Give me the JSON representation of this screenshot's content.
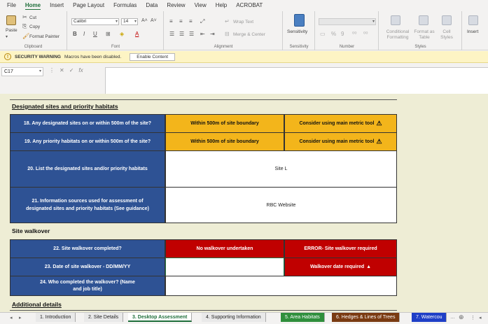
{
  "menu": {
    "tabs": [
      "File",
      "Home",
      "Insert",
      "Page Layout",
      "Formulas",
      "Data",
      "Review",
      "View",
      "Help",
      "ACROBAT"
    ],
    "active": "Home"
  },
  "ribbon": {
    "clipboard": {
      "paste": "Paste",
      "cut": "Cut",
      "copy": "Copy",
      "format_painter": "Format Painter",
      "label": "Clipboard"
    },
    "font": {
      "family": "Calibri",
      "size": "14",
      "label": "Font"
    },
    "alignment": {
      "wrap_text": "Wrap Text",
      "merge_center": "Merge & Center",
      "label": "Alignment"
    },
    "sensitivity": {
      "button": "Sensitivity",
      "label": "Sensitivity"
    },
    "number": {
      "label": "Number"
    },
    "styles": {
      "conditional": "Conditional Formatting",
      "format_table": "Format as Table",
      "cell_styles": "Cell Styles",
      "label": "Styles"
    },
    "cells": {
      "insert": "Insert"
    }
  },
  "security": {
    "title": "SECURITY WARNING",
    "message": "Macros have been disabled.",
    "button": "Enable Content"
  },
  "formula_bar": {
    "name_box": "C17",
    "fx": "fx",
    "value": ""
  },
  "sheet": {
    "section1": "Designated sites and priority habitats",
    "rows1": [
      {
        "q": "18. Any designated sites on or within 500m of the site?",
        "a": "Within 500m of site boundary",
        "b": "Consider using main metric tool"
      },
      {
        "q": "19. Any priority habitats on or within 500m of the site?",
        "a": "Within 500m of site boundary",
        "b": "Consider using main metric tool"
      },
      {
        "q": "20. List the designated sites and/or priority habitats",
        "v": "Site L"
      },
      {
        "q": "21. Information sources used for assessment of designated sites and priority habitats (See guidance)",
        "v": "RBC Website"
      }
    ],
    "section2": "Site walkover",
    "rows2": [
      {
        "q": "22. Site walkover completed?",
        "a": "No walkover undertaken",
        "b": "ERROR- Site walkover required"
      },
      {
        "q": "23. Date of site walkover - DD/MM/YY",
        "a": "",
        "b": "Walkover date required"
      },
      {
        "q": "24. Who completed the walkover? (Name and job title)",
        "v": ""
      }
    ],
    "section3": "Additional details",
    "warning_glyph": "⚠",
    "up_glyph": "▲"
  },
  "sheet_tabs": [
    {
      "label": "1. Introduction",
      "style": "plain"
    },
    {
      "label": "2. Site Details",
      "style": "plain"
    },
    {
      "label": "3. Desktop Assessment",
      "style": "active"
    },
    {
      "label": "4. Supporting Information",
      "style": "plain"
    },
    {
      "label": "5. Area Habitats",
      "style": "green"
    },
    {
      "label": "6. Hedges & Lines of Trees",
      "style": "brown"
    },
    {
      "label": "7. Watercou",
      "style": "blue"
    }
  ],
  "colors": {
    "excel_green": "#1e6e3a",
    "question_blue": "#2e5294",
    "amber": "#f3b51b",
    "red": "#c00000",
    "sheet_bg": "#eeedd5"
  }
}
